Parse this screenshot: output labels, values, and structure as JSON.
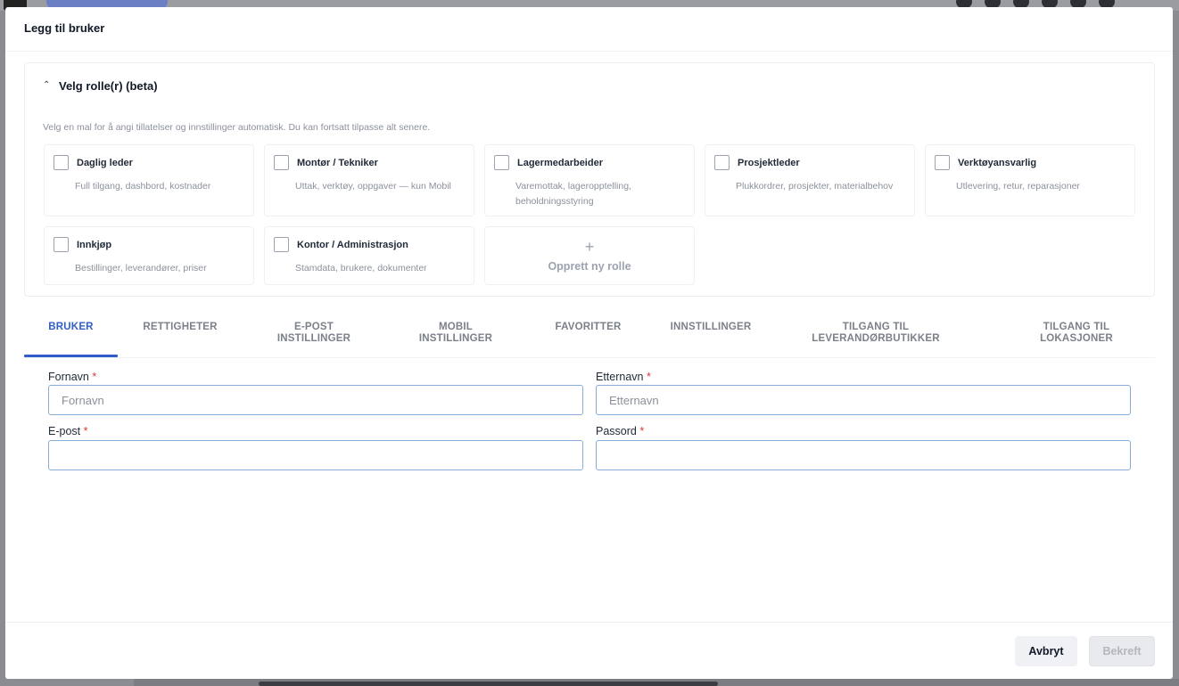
{
  "modal": {
    "title": "Legg til bruker"
  },
  "roles_section": {
    "header": "Velg rolle(r) (beta)",
    "description": "Velg en mal for å angi tillatelser og innstillinger automatisk. Du kan fortsatt tilpasse alt senere.",
    "roles": [
      {
        "name": "Daglig leder",
        "desc": "Full tilgang, dashbord, kostnader",
        "checked": false
      },
      {
        "name": "Montør / Tekniker",
        "desc": "Uttak, verktøy, oppgaver — kun Mobil",
        "checked": false
      },
      {
        "name": "Lagermedarbeider",
        "desc": "Varemottak, lageropptelling, beholdningsstyring",
        "checked": false
      },
      {
        "name": "Prosjektleder",
        "desc": "Plukkordrer, prosjekter, materialbehov",
        "checked": false
      },
      {
        "name": "Verktøyansvarlig",
        "desc": "Utlevering, retur, reparasjoner",
        "checked": false
      },
      {
        "name": "Innkjøp",
        "desc": "Bestillinger, leverandører, priser",
        "checked": false
      },
      {
        "name": "Kontor / Administrasjon",
        "desc": "Stamdata, brukere, dokumenter",
        "checked": false
      }
    ],
    "create_new_label": "Opprett ny rolle"
  },
  "tabs": [
    {
      "line1": "BRUKER",
      "line2": "",
      "active": true
    },
    {
      "line1": "RETTIGHETER",
      "line2": "",
      "active": false
    },
    {
      "line1": "E-POST",
      "line2": "INSTILLINGER",
      "active": false
    },
    {
      "line1": "MOBIL",
      "line2": "INSTILLINGER",
      "active": false
    },
    {
      "line1": "FAVORITTER",
      "line2": "",
      "active": false
    },
    {
      "line1": "INNSTILLINGER",
      "line2": "",
      "active": false
    },
    {
      "line1": "TILGANG TIL",
      "line2": "LEVERANDØRBUTIKKER",
      "active": false
    },
    {
      "line1": "TILGANG TIL",
      "line2": "LOKASJONER",
      "active": false
    }
  ],
  "form": {
    "first_name": {
      "label": "Fornavn",
      "required_mark": "*",
      "placeholder": "Fornavn",
      "value": ""
    },
    "last_name": {
      "label": "Etternavn",
      "required_mark": "*",
      "placeholder": "Etternavn",
      "value": ""
    },
    "email": {
      "label": "E-post",
      "required_mark": "*",
      "placeholder": "",
      "value": ""
    },
    "password": {
      "label": "Passord",
      "required_mark": "*",
      "placeholder": "",
      "value": ""
    }
  },
  "footer": {
    "cancel_label": "Avbryt",
    "confirm_label": "Bekreft"
  },
  "colors": {
    "accent": "#2f5ec9",
    "required": "#d33b3b",
    "input_border": "#86aedb"
  }
}
